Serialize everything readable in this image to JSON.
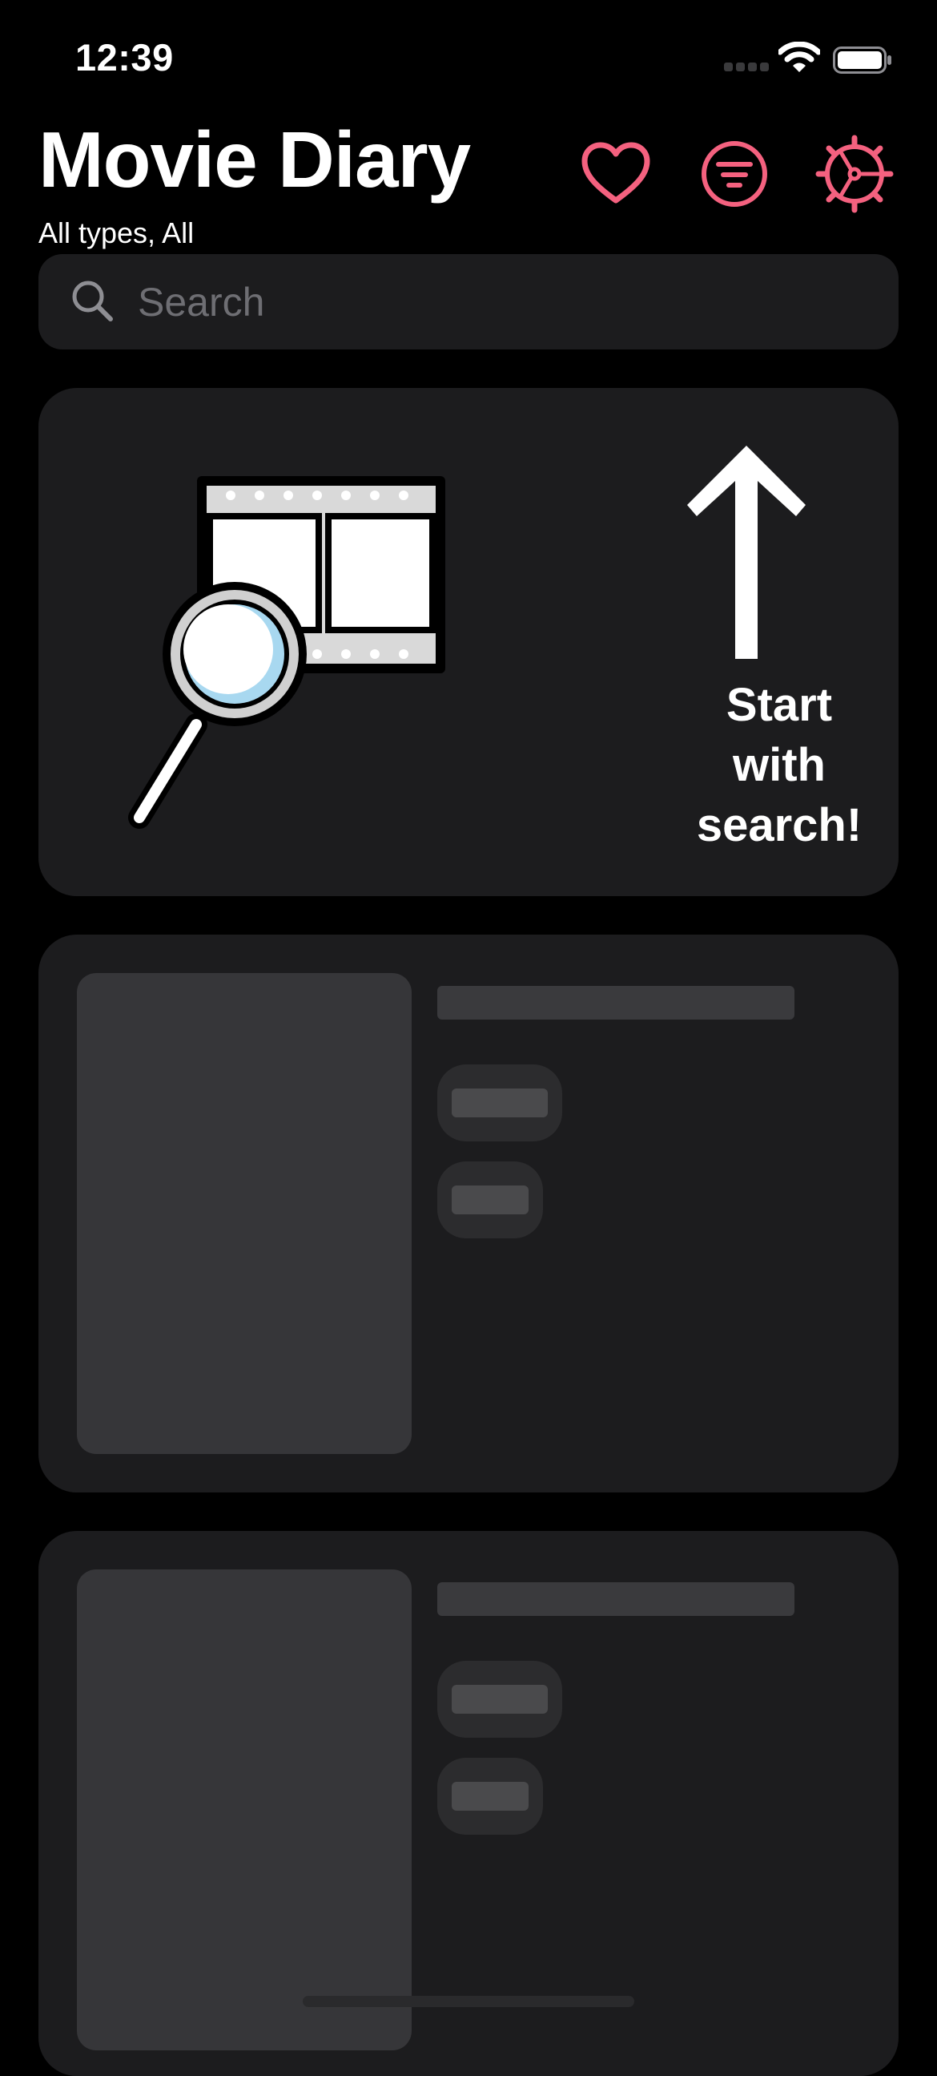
{
  "status_bar": {
    "time": "12:39",
    "icons": [
      "cellular-signal-icon",
      "wifi-icon",
      "battery-icon"
    ]
  },
  "header": {
    "title": "Movie Diary",
    "subtitle": "All types, All",
    "buttons": [
      {
        "icon": "heart-icon",
        "action": "favorites"
      },
      {
        "icon": "filter-icon",
        "action": "filter"
      },
      {
        "icon": "settings-icon",
        "action": "settings"
      }
    ]
  },
  "search": {
    "placeholder": "Search",
    "value": ""
  },
  "hint_card": {
    "illustration": "film-search-icon",
    "arrow": "arrow-up-icon",
    "text": "Start\nwith\nsearch!"
  },
  "colors": {
    "accent": "#f4617f",
    "background": "#000000",
    "card": "#1c1c1e",
    "skeleton": "#363639"
  }
}
